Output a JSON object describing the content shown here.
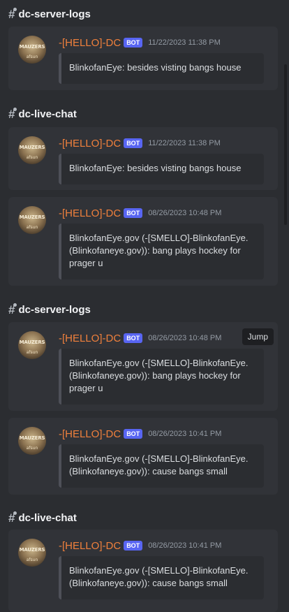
{
  "bot_tag": "BOT",
  "jump_label": "Jump",
  "groups": [
    {
      "channel": "dc-server-logs",
      "messages": [
        {
          "author": "-[HELLO]-DC",
          "timestamp": "11/22/2023 11:38 PM",
          "text": "BlinkofanEye: besides visting bangs house"
        }
      ]
    },
    {
      "channel": "dc-live-chat",
      "messages": [
        {
          "author": "-[HELLO]-DC",
          "timestamp": "11/22/2023 11:38 PM",
          "text": "BlinkofanEye: besides visting bangs house"
        },
        {
          "author": "-[HELLO]-DC",
          "timestamp": "08/26/2023 10:48 PM",
          "text": "BlinkofanEye.gov (-[SMELLO]-BlinkofanEye.\n(Blinkofaneye.gov)): bang plays hockey for\nprager u"
        }
      ]
    },
    {
      "channel": "dc-server-logs",
      "messages": [
        {
          "author": "-[HELLO]-DC",
          "timestamp": "08/26/2023 10:48 PM",
          "text": "BlinkofanEye.gov (-[SMELLO]-BlinkofanEye.\n(Blinkofaneye.gov)): bang plays hockey for\nprager u"
        },
        {
          "author": "-[HELLO]-DC",
          "timestamp": "08/26/2023 10:41 PM",
          "text": "BlinkofanEye.gov (-[SMELLO]-BlinkofanEye.\n(Blinkofaneye.gov)): cause bangs small"
        }
      ]
    },
    {
      "channel": "dc-live-chat",
      "messages": [
        {
          "author": "-[HELLO]-DC",
          "timestamp": "08/26/2023 10:41 PM",
          "text": "BlinkofanEye.gov (-[SMELLO]-BlinkofanEye.\n(Blinkofaneye.gov)): cause bangs small"
        }
      ]
    }
  ],
  "avatar": {
    "line1": "MAUZERS",
    "line2": "afsun"
  }
}
